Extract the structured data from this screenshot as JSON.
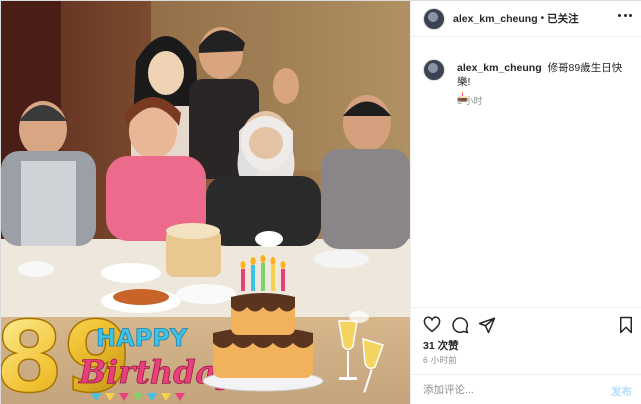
{
  "header": {
    "username": "alex_km_cheung",
    "separator": "•",
    "follow_status": "已关注"
  },
  "caption": {
    "username": "alex_km_cheung",
    "text": "修哥89歲生日快樂!",
    "emoji": "birthday-cake-emoji",
    "time": "6 小时"
  },
  "actions": {
    "icons": [
      "heart-icon",
      "comment-icon",
      "share-icon",
      "bookmark-icon"
    ]
  },
  "likes": "31 次赞",
  "post_time": "6 小时前",
  "add_comment": {
    "placeholder": "添加评论...",
    "post_label": "发布"
  },
  "photo_overlay": {
    "number": "89",
    "happy": "HAPPY",
    "birthday": "Birthday"
  },
  "colors": {
    "accent_blue": "#b2dffc",
    "text_secondary": "#8e8e8e",
    "border": "#dbdbdb"
  }
}
